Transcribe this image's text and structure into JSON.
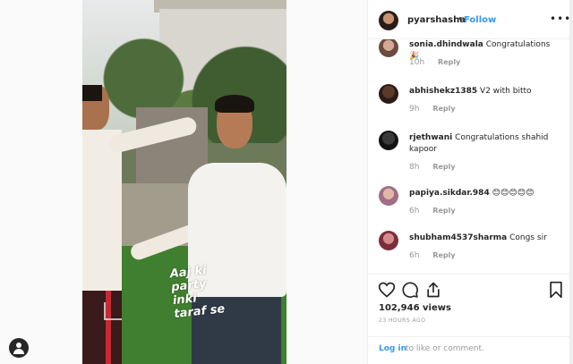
{
  "post": {
    "username": "pyarshasha",
    "dot": "•",
    "follow_label": "Follow",
    "more_label": "•••",
    "caption_lines": [
      "Aaj ki",
      "party",
      "inki",
      "taraf se"
    ]
  },
  "comments": [
    {
      "user": "sonia.dhindwala",
      "text": "Congratulations 🎉",
      "time": "10h",
      "reply": "Reply"
    },
    {
      "user": "abhishekz1385",
      "text": "V2 with bitto",
      "time": "9h",
      "reply": "Reply"
    },
    {
      "user": "rjethwani",
      "text": "Congratulations shahid kapoor",
      "time": "8h",
      "reply": "Reply"
    },
    {
      "user": "papiya.sikdar.984",
      "text": "😊😊😊😊😊",
      "time": "6h",
      "reply": "Reply"
    },
    {
      "user": "shubham4537sharma",
      "text": "Congs sir",
      "time": "6h",
      "reply": "Reply"
    }
  ],
  "stats": {
    "views": "102,946 views",
    "timestamp": "23 HOURS AGO"
  },
  "login": {
    "link": "Log in",
    "text": "to like or comment."
  },
  "icons": {
    "like": "heart-icon",
    "comment": "comment-icon",
    "share": "share-icon",
    "save": "bookmark-icon",
    "profile": "profile-icon"
  },
  "colors": {
    "link_blue": "#3897f0",
    "muted_gray": "#999999"
  }
}
